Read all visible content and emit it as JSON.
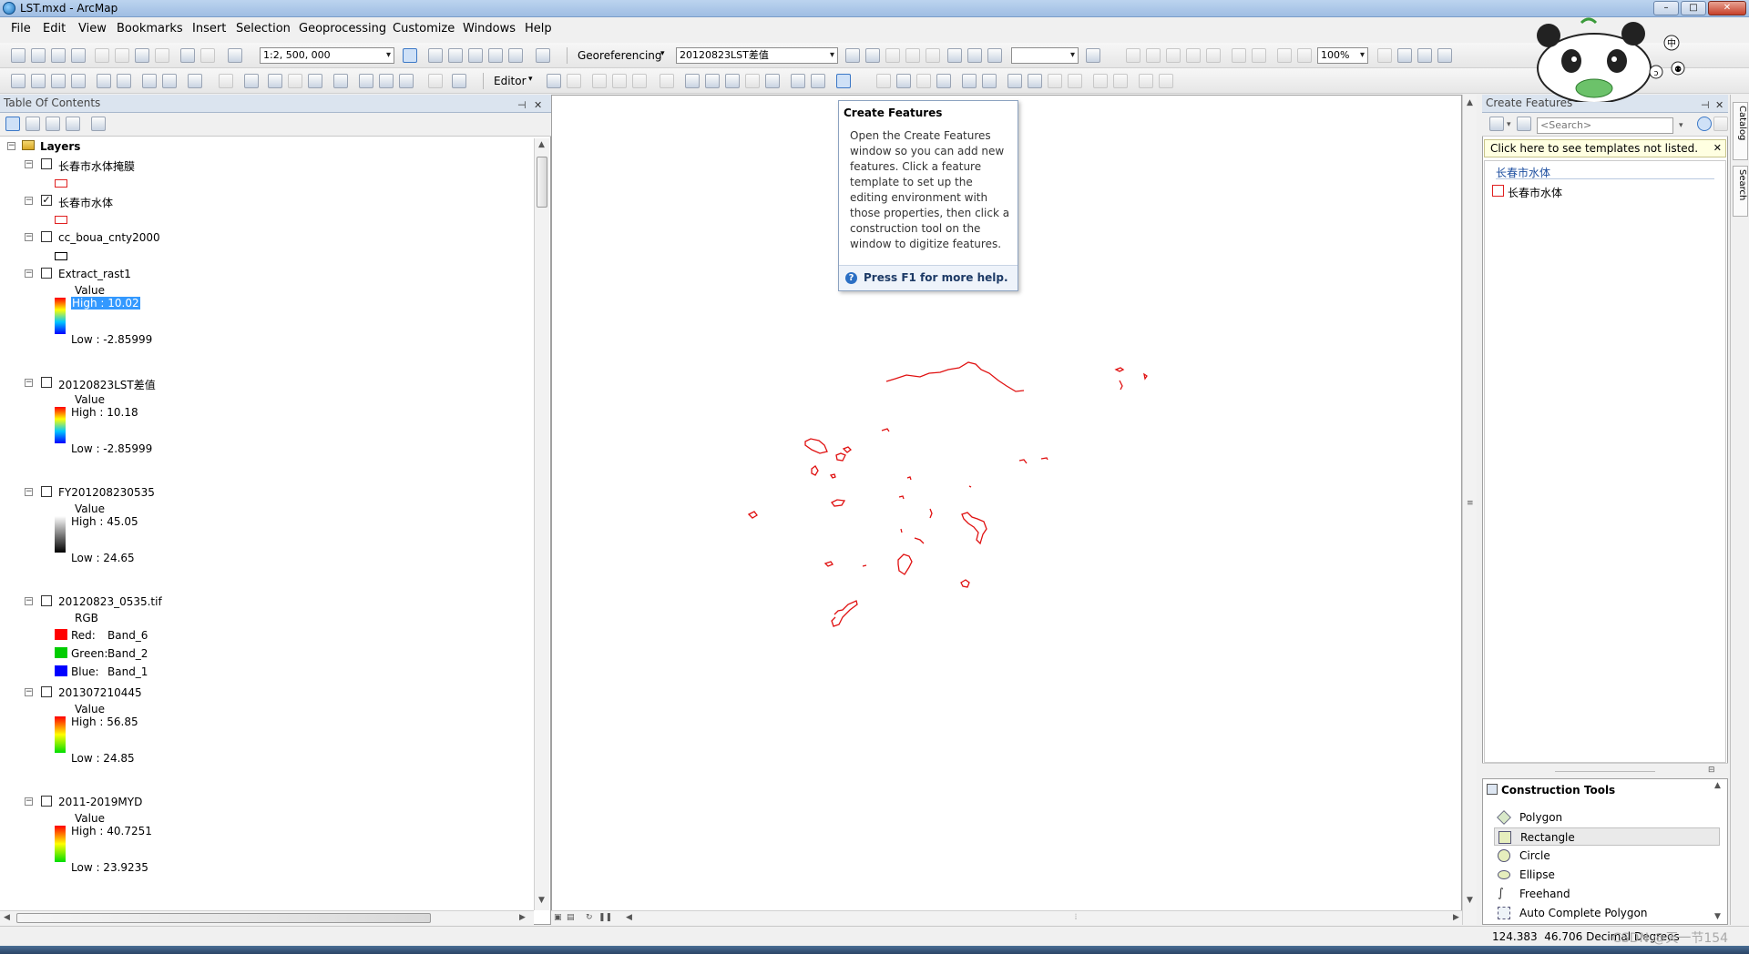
{
  "window": {
    "title": "LST.mxd - ArcMap",
    "minimize": "–",
    "maximize": "□",
    "close": "✕"
  },
  "menu": [
    "File",
    "Edit",
    "View",
    "Bookmarks",
    "Insert",
    "Selection",
    "Geoprocessing",
    "Customize",
    "Windows",
    "Help"
  ],
  "toolbar": {
    "scale": "1:2, 500, 000",
    "georeferencing_label": "Georeferencing",
    "georef_layer": "20120823LST差值",
    "zoom_percent": "100%",
    "editor_label": "Editor"
  },
  "toc": {
    "title": "Table Of Contents",
    "root": "Layers",
    "layers": [
      {
        "name": "长春市水体掩膜",
        "checked": false,
        "legend": {
          "type": "poly",
          "color": "#e02020"
        }
      },
      {
        "name": "长春市水体",
        "checked": true,
        "legend": {
          "type": "poly",
          "color": "#e02020"
        }
      },
      {
        "name": "cc_boua_cnty2000",
        "checked": false,
        "legend": {
          "type": "poly",
          "color": "#000000"
        }
      },
      {
        "name": "Extract_rast1",
        "checked": false,
        "legend": {
          "type": "ramp",
          "field": "Value",
          "high": "High : 10.02",
          "low": "Low : -2.85999",
          "high_selected": true,
          "colors": [
            "#ff0000",
            "#ffff00",
            "#00c8ff",
            "#0000ff"
          ]
        }
      },
      {
        "name": "20120823LST差值",
        "checked": false,
        "legend": {
          "type": "ramp",
          "field": "Value",
          "high": "High : 10.18",
          "low": "Low : -2.85999",
          "colors": [
            "#ff0000",
            "#ffff00",
            "#00c8ff",
            "#0000ff"
          ]
        }
      },
      {
        "name": "FY201208230535",
        "checked": false,
        "legend": {
          "type": "ramp",
          "field": "Value",
          "high": "High : 45.05",
          "low": "Low : 24.65",
          "colors": [
            "#ffffff",
            "#000000"
          ]
        }
      },
      {
        "name": "20120823_0535.tif",
        "checked": false,
        "legend": {
          "type": "rgb",
          "field": "RGB",
          "bands": [
            {
              "label": "Red:",
              "band": "Band_6",
              "color": "#ff0000"
            },
            {
              "label": "Green:",
              "band": "Band_2",
              "color": "#00cc00"
            },
            {
              "label": "Blue:",
              "band": "Band_1",
              "color": "#0000ff"
            }
          ]
        }
      },
      {
        "name": "201307210445",
        "checked": false,
        "legend": {
          "type": "ramp",
          "field": "Value",
          "high": "High : 56.85",
          "low": "Low : 24.85",
          "colors": [
            "#ff0000",
            "#ffff00",
            "#00dd00"
          ]
        }
      },
      {
        "name": "2011-2019MYD",
        "checked": false,
        "legend": {
          "type": "ramp",
          "field": "Value",
          "high": "High : 40.7251",
          "low": "Low : 23.9235",
          "colors": [
            "#ff0000",
            "#ffff00",
            "#00dd00"
          ]
        }
      }
    ]
  },
  "tooltip": {
    "title": "Create Features",
    "body": "Open the Create Features window so you can add new features. Click a feature template to set up the editing environment with those properties, then click a construction tool on the window to digitize features.",
    "help": "Press F1 for more help."
  },
  "create_features": {
    "title": "Create Features",
    "search_placeholder": "<Search>",
    "notice": "Click here to see templates not listed.",
    "group": "长春市水体",
    "template": "长春市水体"
  },
  "construction_tools": {
    "title": "Construction Tools",
    "tools": [
      "Polygon",
      "Rectangle",
      "Circle",
      "Ellipse",
      "Freehand",
      "Auto Complete Polygon"
    ],
    "selected": "Rectangle"
  },
  "side_tabs": [
    "Catalog",
    "Search"
  ],
  "status": {
    "x": "124.383",
    "y": "46.706",
    "units": "Decimal Degrees"
  },
  "panda": {
    "badge1": "中",
    "badge2": "ɔ",
    "badge3": "⚉"
  },
  "watermark": "CSDN @天一节154"
}
